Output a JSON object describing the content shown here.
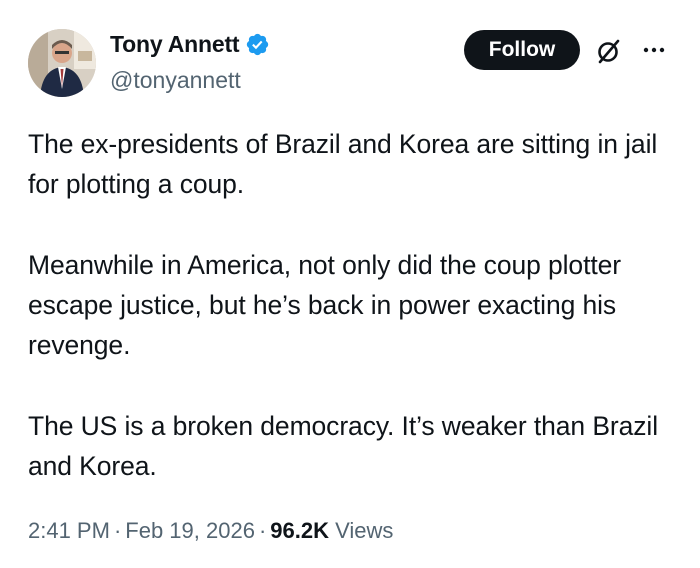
{
  "author": {
    "name": "Tony Annett",
    "handle": "@tonyannett",
    "verified": true,
    "verified_color": "#1d9bf0"
  },
  "actions": {
    "follow_label": "Follow",
    "grok_icon": "grok-icon",
    "more_icon": "more-options-icon"
  },
  "tweet": {
    "paragraphs": [
      "The ex-presidents of Brazil and Korea are sitting in jail for plotting a coup.",
      "Meanwhile in America, not only did the coup plotter escape justice, but he’s back in power exacting his revenge.",
      "The US is a broken democracy. It’s weaker than Brazil and Korea."
    ]
  },
  "meta": {
    "time": "2:41 PM",
    "separator": "·",
    "date": "Feb 19, 2026",
    "views_count": "96.2K",
    "views_label": "Views"
  },
  "colors": {
    "text": "#0f1419",
    "secondary": "#536471",
    "follow_bg": "#0f1419"
  }
}
